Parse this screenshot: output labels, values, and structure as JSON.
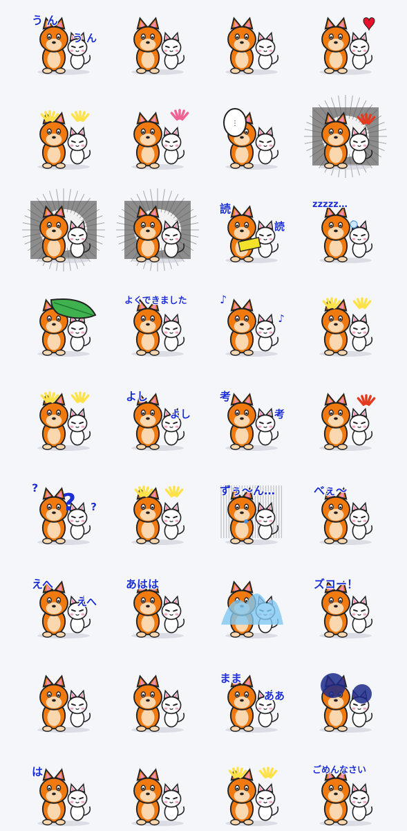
{
  "colors": {
    "background": "#f5f6fa",
    "dog_orange": "#f07a10",
    "dog_belly": "#fbd7b0",
    "cat_white": "#ffffff",
    "outline": "#222222",
    "caption_blue": "#1a2fd6",
    "accent_pink": "#f48fb1",
    "heart_red": "#e8102a",
    "burst_yellow": "#ffe14a",
    "burst_red": "#e23b1f"
  },
  "stickers": [
    {
      "caption": "う ん",
      "caption2": "う ん",
      "effect": "none",
      "bg": "none"
    },
    {
      "caption": "",
      "caption2": "",
      "effect": "hug",
      "bg": "none"
    },
    {
      "caption": "",
      "caption2": "",
      "effect": "kiss",
      "bg": "none"
    },
    {
      "caption": "",
      "caption2": "",
      "effect": "heart",
      "bg": "none"
    },
    {
      "caption": "",
      "caption2": "",
      "effect": "burst-yellow",
      "bg": "none"
    },
    {
      "caption": "",
      "caption2": "",
      "effect": "burst-pink",
      "bg": "none"
    },
    {
      "caption": "",
      "caption2": "",
      "effect": "speech",
      "bg": "none"
    },
    {
      "caption": "",
      "caption2": "",
      "effect": "burst-red",
      "bg": "speed"
    },
    {
      "caption": "",
      "caption2": "",
      "effect": "none",
      "bg": "speed"
    },
    {
      "caption": "",
      "caption2": "",
      "effect": "none",
      "bg": "speed"
    },
    {
      "caption": "読",
      "caption2": "読",
      "effect": "book",
      "bg": "none"
    },
    {
      "caption": "zzzzz…",
      "caption2": "",
      "effect": "sleep",
      "bg": "none"
    },
    {
      "caption": "",
      "caption2": "",
      "effect": "leaf",
      "bg": "none"
    },
    {
      "caption": "よくできました",
      "caption2": "",
      "effect": "none",
      "bg": "none"
    },
    {
      "caption": "♪",
      "caption2": "♪",
      "effect": "none",
      "bg": "none"
    },
    {
      "caption": "",
      "caption2": "",
      "effect": "burst-yellow",
      "bg": "none"
    },
    {
      "caption": "",
      "caption2": "",
      "effect": "burst-yellow",
      "bg": "none"
    },
    {
      "caption": "よし",
      "caption2": "よし",
      "effect": "none",
      "bg": "none"
    },
    {
      "caption": "考",
      "caption2": "考",
      "effect": "none",
      "bg": "none"
    },
    {
      "caption": "",
      "caption2": "",
      "effect": "burst-red",
      "bg": "none"
    },
    {
      "caption": "?",
      "caption2": "?",
      "effect": "question",
      "bg": "none"
    },
    {
      "caption": "",
      "caption2": "",
      "effect": "burst-yellow",
      "bg": "none"
    },
    {
      "caption": "ずぅ～ん…",
      "caption2": "",
      "effect": "gloom",
      "bg": "lines"
    },
    {
      "caption": "べぇ～",
      "caption2": "",
      "effect": "none",
      "bg": "none"
    },
    {
      "caption": "えへ",
      "caption2": "えへ",
      "effect": "none",
      "bg": "none"
    },
    {
      "caption": "あはは",
      "caption2": "",
      "effect": "none",
      "bg": "none"
    },
    {
      "caption": "",
      "caption2": "",
      "effect": "splash",
      "bg": "none"
    },
    {
      "caption": "ズコー！",
      "caption2": "",
      "effect": "none",
      "bg": "none"
    },
    {
      "caption": "",
      "caption2": "",
      "effect": "none",
      "bg": "none"
    },
    {
      "caption": "",
      "caption2": "",
      "effect": "none",
      "bg": "none"
    },
    {
      "caption": "まま",
      "caption2": "ああ",
      "effect": "none",
      "bg": "none"
    },
    {
      "caption": "",
      "caption2": "",
      "effect": "dark",
      "bg": "none"
    },
    {
      "caption": "は",
      "caption2": "",
      "effect": "none",
      "bg": "none"
    },
    {
      "caption": "",
      "caption2": "",
      "effect": "none",
      "bg": "none"
    },
    {
      "caption": "",
      "caption2": "",
      "effect": "burst-yellow",
      "bg": "none"
    },
    {
      "caption": "ごめんなさい",
      "caption2": "",
      "effect": "bow",
      "bg": "none"
    }
  ]
}
